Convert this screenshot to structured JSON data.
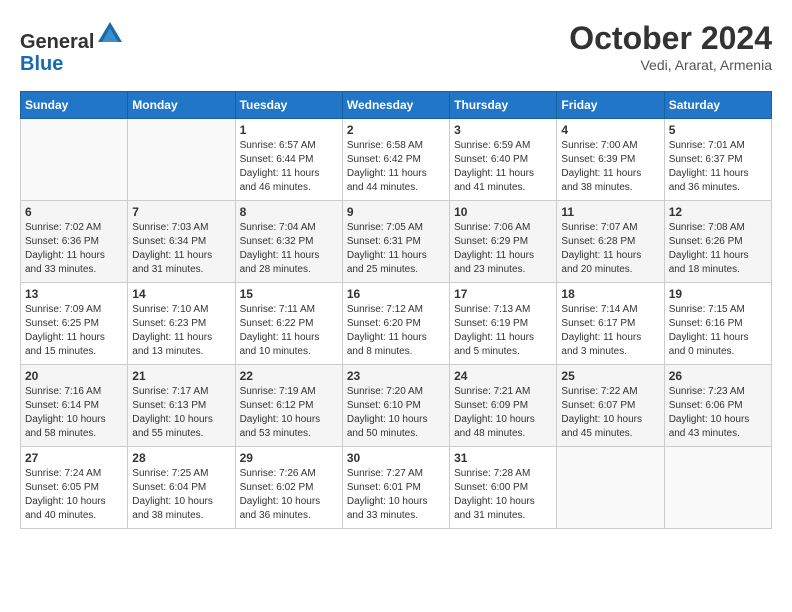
{
  "header": {
    "logo_general": "General",
    "logo_blue": "Blue",
    "month_title": "October 2024",
    "location": "Vedi, Ararat, Armenia"
  },
  "days_of_week": [
    "Sunday",
    "Monday",
    "Tuesday",
    "Wednesday",
    "Thursday",
    "Friday",
    "Saturday"
  ],
  "weeks": [
    [
      {
        "day": "",
        "info": ""
      },
      {
        "day": "",
        "info": ""
      },
      {
        "day": "1",
        "info": "Sunrise: 6:57 AM\nSunset: 6:44 PM\nDaylight: 11 hours and 46 minutes."
      },
      {
        "day": "2",
        "info": "Sunrise: 6:58 AM\nSunset: 6:42 PM\nDaylight: 11 hours and 44 minutes."
      },
      {
        "day": "3",
        "info": "Sunrise: 6:59 AM\nSunset: 6:40 PM\nDaylight: 11 hours and 41 minutes."
      },
      {
        "day": "4",
        "info": "Sunrise: 7:00 AM\nSunset: 6:39 PM\nDaylight: 11 hours and 38 minutes."
      },
      {
        "day": "5",
        "info": "Sunrise: 7:01 AM\nSunset: 6:37 PM\nDaylight: 11 hours and 36 minutes."
      }
    ],
    [
      {
        "day": "6",
        "info": "Sunrise: 7:02 AM\nSunset: 6:36 PM\nDaylight: 11 hours and 33 minutes."
      },
      {
        "day": "7",
        "info": "Sunrise: 7:03 AM\nSunset: 6:34 PM\nDaylight: 11 hours and 31 minutes."
      },
      {
        "day": "8",
        "info": "Sunrise: 7:04 AM\nSunset: 6:32 PM\nDaylight: 11 hours and 28 minutes."
      },
      {
        "day": "9",
        "info": "Sunrise: 7:05 AM\nSunset: 6:31 PM\nDaylight: 11 hours and 25 minutes."
      },
      {
        "day": "10",
        "info": "Sunrise: 7:06 AM\nSunset: 6:29 PM\nDaylight: 11 hours and 23 minutes."
      },
      {
        "day": "11",
        "info": "Sunrise: 7:07 AM\nSunset: 6:28 PM\nDaylight: 11 hours and 20 minutes."
      },
      {
        "day": "12",
        "info": "Sunrise: 7:08 AM\nSunset: 6:26 PM\nDaylight: 11 hours and 18 minutes."
      }
    ],
    [
      {
        "day": "13",
        "info": "Sunrise: 7:09 AM\nSunset: 6:25 PM\nDaylight: 11 hours and 15 minutes."
      },
      {
        "day": "14",
        "info": "Sunrise: 7:10 AM\nSunset: 6:23 PM\nDaylight: 11 hours and 13 minutes."
      },
      {
        "day": "15",
        "info": "Sunrise: 7:11 AM\nSunset: 6:22 PM\nDaylight: 11 hours and 10 minutes."
      },
      {
        "day": "16",
        "info": "Sunrise: 7:12 AM\nSunset: 6:20 PM\nDaylight: 11 hours and 8 minutes."
      },
      {
        "day": "17",
        "info": "Sunrise: 7:13 AM\nSunset: 6:19 PM\nDaylight: 11 hours and 5 minutes."
      },
      {
        "day": "18",
        "info": "Sunrise: 7:14 AM\nSunset: 6:17 PM\nDaylight: 11 hours and 3 minutes."
      },
      {
        "day": "19",
        "info": "Sunrise: 7:15 AM\nSunset: 6:16 PM\nDaylight: 11 hours and 0 minutes."
      }
    ],
    [
      {
        "day": "20",
        "info": "Sunrise: 7:16 AM\nSunset: 6:14 PM\nDaylight: 10 hours and 58 minutes."
      },
      {
        "day": "21",
        "info": "Sunrise: 7:17 AM\nSunset: 6:13 PM\nDaylight: 10 hours and 55 minutes."
      },
      {
        "day": "22",
        "info": "Sunrise: 7:19 AM\nSunset: 6:12 PM\nDaylight: 10 hours and 53 minutes."
      },
      {
        "day": "23",
        "info": "Sunrise: 7:20 AM\nSunset: 6:10 PM\nDaylight: 10 hours and 50 minutes."
      },
      {
        "day": "24",
        "info": "Sunrise: 7:21 AM\nSunset: 6:09 PM\nDaylight: 10 hours and 48 minutes."
      },
      {
        "day": "25",
        "info": "Sunrise: 7:22 AM\nSunset: 6:07 PM\nDaylight: 10 hours and 45 minutes."
      },
      {
        "day": "26",
        "info": "Sunrise: 7:23 AM\nSunset: 6:06 PM\nDaylight: 10 hours and 43 minutes."
      }
    ],
    [
      {
        "day": "27",
        "info": "Sunrise: 7:24 AM\nSunset: 6:05 PM\nDaylight: 10 hours and 40 minutes."
      },
      {
        "day": "28",
        "info": "Sunrise: 7:25 AM\nSunset: 6:04 PM\nDaylight: 10 hours and 38 minutes."
      },
      {
        "day": "29",
        "info": "Sunrise: 7:26 AM\nSunset: 6:02 PM\nDaylight: 10 hours and 36 minutes."
      },
      {
        "day": "30",
        "info": "Sunrise: 7:27 AM\nSunset: 6:01 PM\nDaylight: 10 hours and 33 minutes."
      },
      {
        "day": "31",
        "info": "Sunrise: 7:28 AM\nSunset: 6:00 PM\nDaylight: 10 hours and 31 minutes."
      },
      {
        "day": "",
        "info": ""
      },
      {
        "day": "",
        "info": ""
      }
    ]
  ]
}
